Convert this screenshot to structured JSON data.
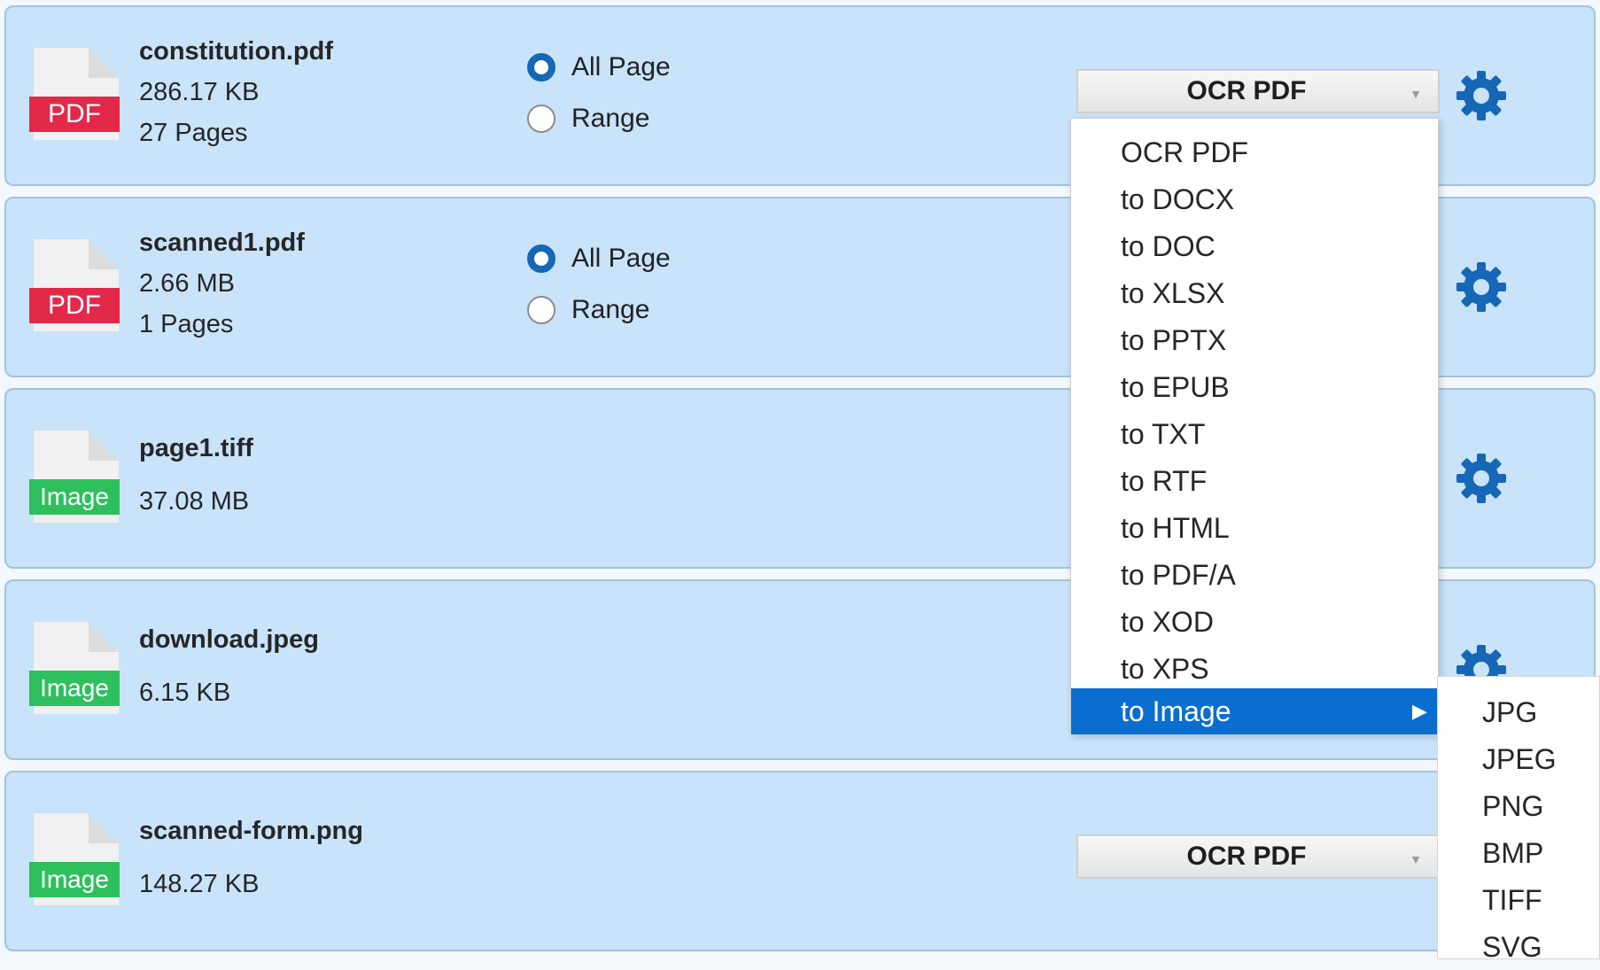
{
  "files": [
    {
      "name": "constitution.pdf",
      "size": "286.17 KB",
      "pages": "27 Pages",
      "type": "PDF",
      "has_range": true,
      "conversion": "OCR PDF"
    },
    {
      "name": "scanned1.pdf",
      "size": "2.66 MB",
      "pages": "1 Pages",
      "type": "PDF",
      "has_range": true,
      "conversion": ""
    },
    {
      "name": "page1.tiff",
      "size": "37.08 MB",
      "pages": "",
      "type": "Image",
      "has_range": false,
      "conversion": ""
    },
    {
      "name": "download.jpeg",
      "size": "6.15 KB",
      "pages": "",
      "type": "Image",
      "has_range": false,
      "conversion": ""
    },
    {
      "name": "scanned-form.png",
      "size": "148.27 KB",
      "pages": "",
      "type": "Image",
      "has_range": false,
      "conversion": "OCR PDF"
    }
  ],
  "page_options": {
    "all": "All Page",
    "range": "Range",
    "selected": "All Page"
  },
  "dropdown": {
    "items": [
      "OCR PDF",
      "to DOCX",
      "to DOC",
      "to XLSX",
      "to PPTX",
      "to EPUB",
      "to TXT",
      "to RTF",
      "to HTML",
      "to PDF/A",
      "to XOD",
      "to XPS",
      "to Image"
    ],
    "highlighted": "to Image",
    "submenu": [
      "JPG",
      "JPEG",
      "PNG",
      "BMP",
      "TIFF",
      "SVG"
    ]
  },
  "colors": {
    "row_bg": "#c8e3fa",
    "pdf_badge": "#e2294a",
    "image_badge": "#2fc05e",
    "gear": "#1667b5",
    "highlight": "#0a6ed1"
  },
  "icons": {
    "gear": "gear-icon",
    "file": "file-icon",
    "submenu_arrow": "chevron-right-icon"
  }
}
